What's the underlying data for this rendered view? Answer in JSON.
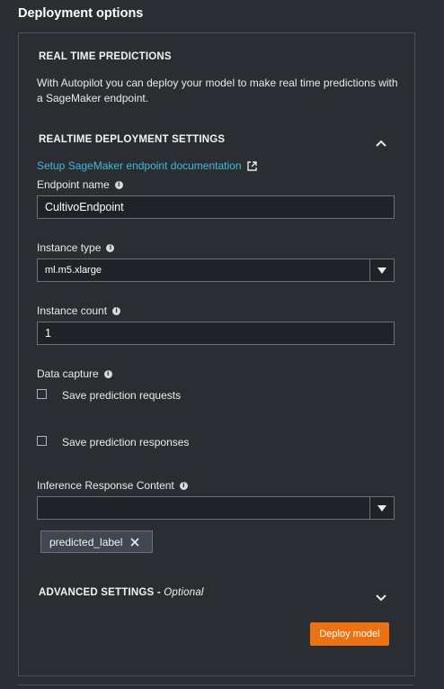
{
  "panel": {
    "title": "Deployment options"
  },
  "realtime": {
    "heading": "REAL TIME PREDICTIONS",
    "description": "With Autopilot you can deploy your model to make real time predictions with a SageMaker endpoint."
  },
  "settings": {
    "heading": "REALTIME DEPLOYMENT SETTINGS",
    "doc_link": "Setup SageMaker endpoint documentation",
    "endpoint_name_label": "Endpoint name",
    "endpoint_name_value": "CultivoEndpoint",
    "instance_type_label": "Instance type",
    "instance_type_value": "ml.m5.xlarge",
    "instance_count_label": "Instance count",
    "instance_count_value": "1",
    "data_capture_label": "Data capture",
    "save_requests_label": "Save prediction requests",
    "save_responses_label": "Save prediction responses",
    "inference_label": "Inference Response Content",
    "inference_value": "",
    "token_label": "predicted_label"
  },
  "advanced": {
    "heading": "ADVANCED SETTINGS",
    "optional": "Optional",
    "separator": " - "
  },
  "actions": {
    "deploy_label": "Deploy model"
  },
  "icons": {
    "info": "info-icon",
    "external": "external-link-icon",
    "collapse": "chevron-up-icon",
    "expand": "chevron-down-icon",
    "dropdown": "caret-down-icon",
    "remove": "close-icon"
  },
  "colors": {
    "accent": "#ec7211",
    "link": "#44b9d6",
    "background": "#2a2e33"
  }
}
